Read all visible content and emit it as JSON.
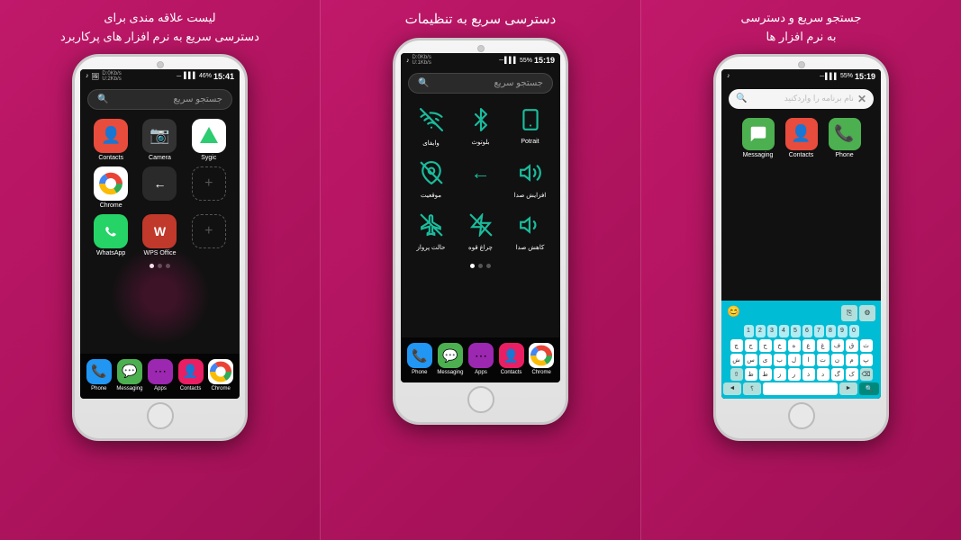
{
  "panels": [
    {
      "id": "panel1",
      "title": "لیست علاقه مندی برای\nدسترسی سریع به نرم افزار های پرکاربرد",
      "search_placeholder": "جستجو سریع",
      "status": {
        "time": "15:41",
        "battery": "46%",
        "speed_down": "D:0Kb/s",
        "speed_up": "U:2Kb/s"
      },
      "apps": [
        {
          "label": "Contacts",
          "icon": "👤",
          "color": "#e74c3c"
        },
        {
          "label": "Camera",
          "icon": "📷",
          "color": "#333"
        },
        {
          "label": "Sygic",
          "icon": "🗺",
          "color": "#2ecc71"
        },
        {
          "label": "Chrome",
          "icon": "◎",
          "color": "#fff"
        },
        {
          "label": "←",
          "icon": "←",
          "color": "#2a2a2a"
        },
        {
          "label": "+",
          "icon": "+",
          "color": "transparent"
        },
        {
          "label": "WhatsApp",
          "icon": "💬",
          "color": "#25d366"
        },
        {
          "label": "WPS Office",
          "icon": "W",
          "color": "#c0392b"
        },
        {
          "label": "+",
          "icon": "+",
          "color": "transparent"
        }
      ],
      "dock": [
        {
          "label": "Phone",
          "icon": "📞",
          "color": "#2196f3"
        },
        {
          "label": "Messaging",
          "icon": "💬",
          "color": "#4caf50"
        },
        {
          "label": "Apps",
          "icon": "⋯",
          "color": "#9c27b0"
        },
        {
          "label": "Contacts",
          "icon": "👤",
          "color": "#e91e63"
        },
        {
          "label": "Chrome",
          "icon": "◎",
          "color": "#ff9800"
        }
      ]
    },
    {
      "id": "panel2",
      "title": "دسترسی سریع به تنظیمات",
      "search_placeholder": "جستجو سریع",
      "status": {
        "time": "15:19",
        "battery": "55%",
        "speed_down": "D:0Kb/s",
        "speed_up": "U:1Kb/s"
      },
      "settings": [
        {
          "label": "وایفای",
          "icon": "wifi_off"
        },
        {
          "label": "بلوتوث",
          "icon": "bluetooth"
        },
        {
          "label": "Potrait",
          "icon": "phone_portrait"
        },
        {
          "label": "موقعیت",
          "icon": "location_off"
        },
        {
          "label": "←",
          "icon": "back"
        },
        {
          "label": "افزایش صدا",
          "icon": "volume_up"
        },
        {
          "label": "حالت پرواز",
          "icon": "flight"
        },
        {
          "label": "چراغ قوه",
          "icon": "flashlight_off"
        },
        {
          "label": "کاهش صدا",
          "icon": "volume_down"
        }
      ],
      "dock": [
        {
          "label": "Phone",
          "icon": "📞",
          "color": "#2196f3"
        },
        {
          "label": "Messaging",
          "icon": "💬",
          "color": "#4caf50"
        },
        {
          "label": "Apps",
          "icon": "⋯",
          "color": "#9c27b0"
        },
        {
          "label": "Contacts",
          "icon": "👤",
          "color": "#e91e63"
        },
        {
          "label": "Chrome",
          "icon": "◎",
          "color": "#ff9800"
        }
      ]
    },
    {
      "id": "panel3",
      "title": "جستجو سریع و دسترسی\nبه نرم افزار ها",
      "search_placeholder": "نام برنامه را واردکنید",
      "status": {
        "time": "15:19",
        "battery": "55%"
      },
      "result_apps": [
        {
          "label": "Messaging",
          "icon": "💬"
        },
        {
          "label": "Contacts",
          "icon": "👤"
        },
        {
          "label": "Phone",
          "icon": "📞"
        }
      ],
      "keyboard": {
        "numbers": [
          "1",
          "2",
          "3",
          "4",
          "5",
          "6",
          "7",
          "8",
          "9",
          "0"
        ],
        "row1": [
          "چ",
          "ج",
          "ح",
          "خ",
          "ه",
          "ع",
          "غ",
          "ف",
          "ق",
          "ث"
        ],
        "row2": [
          "ش",
          "س",
          "ی",
          "ب",
          "ل",
          "ا",
          "ت",
          "ن",
          "م",
          "پ"
        ],
        "row3": [
          "ظ",
          "ط",
          "ز",
          "ر",
          "ذ",
          "د",
          "گ",
          "ک"
        ],
        "row4": [
          "←",
          "space",
          "→",
          "search"
        ]
      }
    }
  ]
}
